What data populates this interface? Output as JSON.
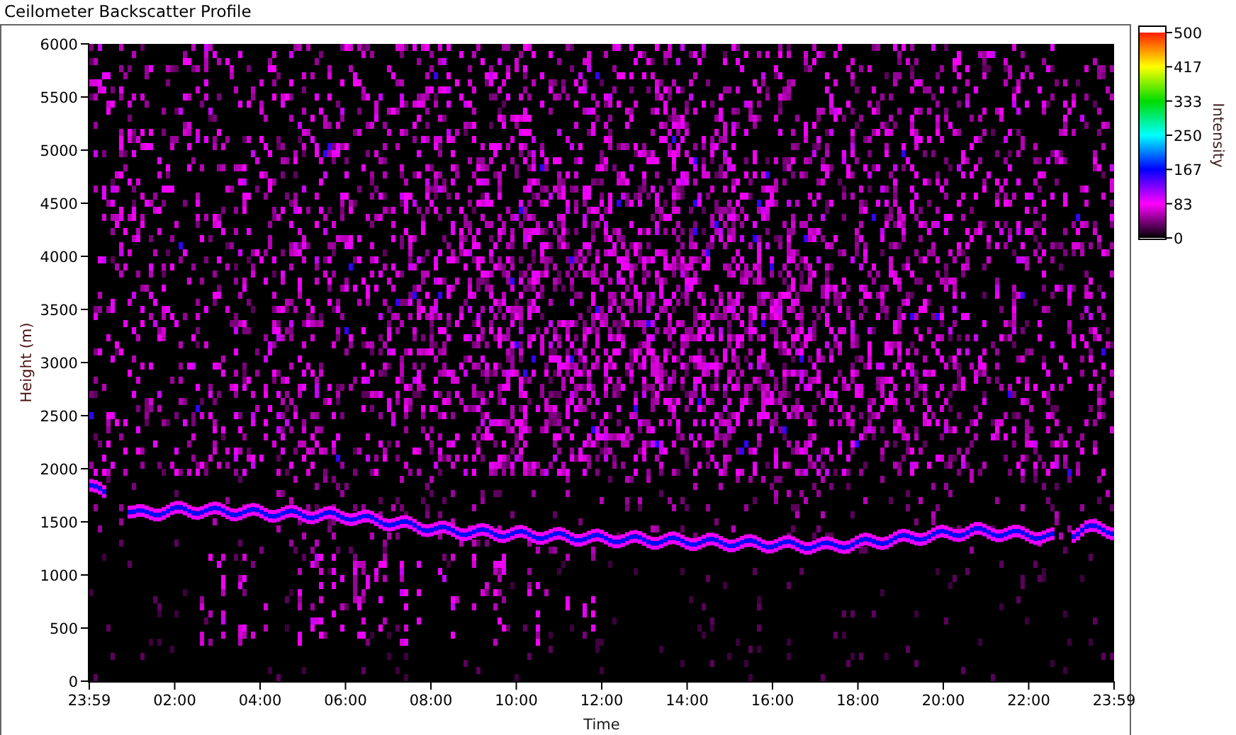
{
  "title": "Ceilometer Backscatter Profile",
  "plot": {
    "ylabel": "Height (m)",
    "xlabel": "Time",
    "yticks": [
      "6000",
      "5500",
      "5000",
      "4500",
      "4000",
      "3500",
      "3000",
      "2500",
      "2000",
      "1500",
      "1000",
      "500",
      "0"
    ],
    "xticks": [
      "23:59",
      "02:00",
      "04:00",
      "06:00",
      "08:00",
      "10:00",
      "12:00",
      "14:00",
      "16:00",
      "18:00",
      "20:00",
      "22:00",
      "23:59"
    ]
  },
  "color_scale": {
    "label": "Intensity",
    "ticks": [
      "500",
      "417",
      "333",
      "250",
      "167",
      "83",
      "0"
    ]
  }
}
